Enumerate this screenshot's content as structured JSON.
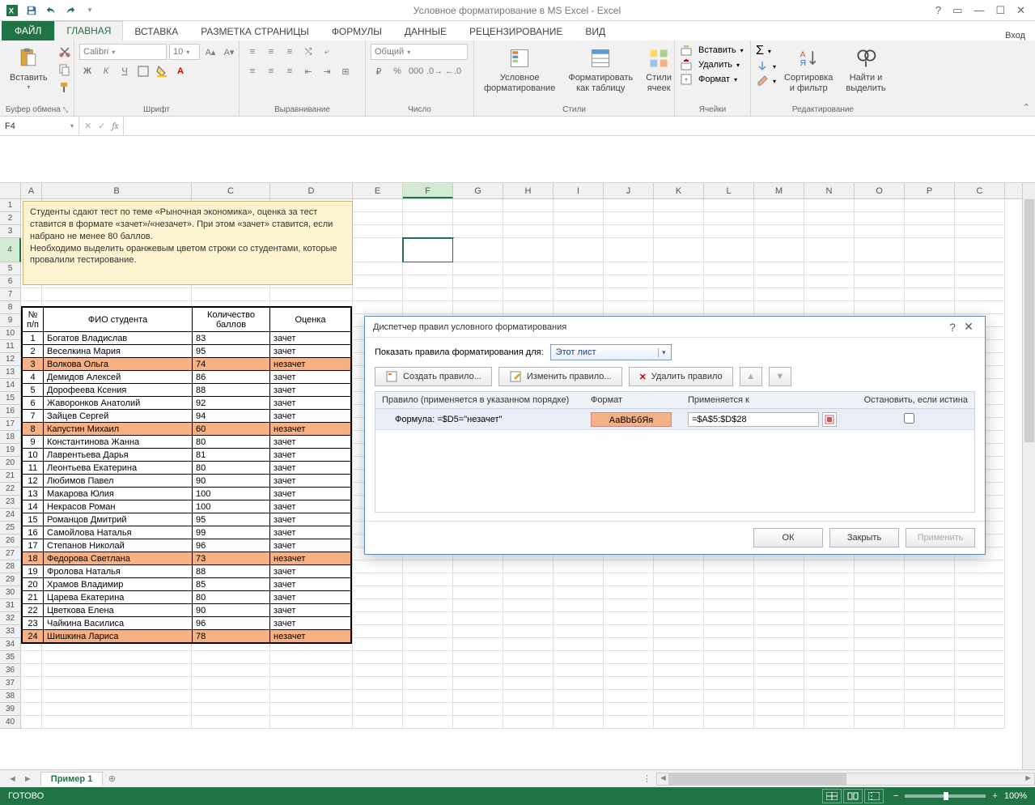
{
  "app": {
    "title": "Условное форматирование в MS Excel - Excel",
    "signin": "Вход"
  },
  "tabs": {
    "file": "ФАЙЛ",
    "home": "ГЛАВНАЯ",
    "insert": "ВСТАВКА",
    "layout": "РАЗМЕТКА СТРАНИЦЫ",
    "formulas": "ФОРМУЛЫ",
    "data": "ДАННЫЕ",
    "review": "РЕЦЕНЗИРОВАНИЕ",
    "view": "ВИД"
  },
  "ribbon": {
    "clipboard": {
      "label": "Буфер обмена",
      "paste": "Вставить"
    },
    "font": {
      "label": "Шрифт",
      "family": "Calibri",
      "size": "10"
    },
    "align": {
      "label": "Выравнивание"
    },
    "number": {
      "label": "Число",
      "format": "Общий"
    },
    "styles": {
      "label": "Стили",
      "cf": "Условное\nформатирование",
      "fmt_table": "Форматировать\nкак таблицу",
      "cell_styles": "Стили\nячеек"
    },
    "cells": {
      "label": "Ячейки",
      "insert": "Вставить",
      "delete": "Удалить",
      "format": "Формат"
    },
    "editing": {
      "label": "Редактирование",
      "sort": "Сортировка\nи фильтр",
      "find": "Найти и\nвыделить"
    }
  },
  "namebox": "F4",
  "note": "Студенты сдают тест по теме «Рыночная экономика», оценка за тест ставится в формате «зачет»/«незачет». При этом «зачет» ставится, если набрано не менее 80 баллов.\nНеобходимо выделить оранжевым цветом строки со студентами, которые провалили тестирование.",
  "table": {
    "headers": {
      "num": "№\nп/п",
      "name": "ФИО студента",
      "score": "Количество\nбаллов",
      "grade": "Оценка"
    },
    "rows": [
      {
        "n": "1",
        "name": "Богатов Владислав",
        "score": "83",
        "grade": "зачет",
        "fail": false
      },
      {
        "n": "2",
        "name": "Веселкина Мария",
        "score": "95",
        "grade": "зачет",
        "fail": false
      },
      {
        "n": "3",
        "name": "Волкова Ольга",
        "score": "74",
        "grade": "незачет",
        "fail": true
      },
      {
        "n": "4",
        "name": "Демидов Алексей",
        "score": "86",
        "grade": "зачет",
        "fail": false
      },
      {
        "n": "5",
        "name": "Дорофеева Ксения",
        "score": "88",
        "grade": "зачет",
        "fail": false
      },
      {
        "n": "6",
        "name": "Жаворонков Анатолий",
        "score": "92",
        "grade": "зачет",
        "fail": false
      },
      {
        "n": "7",
        "name": "Зайцев Сергей",
        "score": "94",
        "grade": "зачет",
        "fail": false
      },
      {
        "n": "8",
        "name": "Капустин Михаил",
        "score": "60",
        "grade": "незачет",
        "fail": true
      },
      {
        "n": "9",
        "name": "Константинова Жанна",
        "score": "80",
        "grade": "зачет",
        "fail": false
      },
      {
        "n": "10",
        "name": "Лаврентьева Дарья",
        "score": "81",
        "grade": "зачет",
        "fail": false
      },
      {
        "n": "11",
        "name": "Леонтьева Екатерина",
        "score": "80",
        "grade": "зачет",
        "fail": false
      },
      {
        "n": "12",
        "name": "Любимов Павел",
        "score": "90",
        "grade": "зачет",
        "fail": false
      },
      {
        "n": "13",
        "name": "Макарова Юлия",
        "score": "100",
        "grade": "зачет",
        "fail": false
      },
      {
        "n": "14",
        "name": "Некрасов Роман",
        "score": "100",
        "grade": "зачет",
        "fail": false
      },
      {
        "n": "15",
        "name": "Романцов Дмитрий",
        "score": "95",
        "grade": "зачет",
        "fail": false
      },
      {
        "n": "16",
        "name": "Самойлова Наталья",
        "score": "99",
        "grade": "зачет",
        "fail": false
      },
      {
        "n": "17",
        "name": "Степанов Николай",
        "score": "96",
        "grade": "зачет",
        "fail": false
      },
      {
        "n": "18",
        "name": "Федорова Светлана",
        "score": "73",
        "grade": "незачет",
        "fail": true
      },
      {
        "n": "19",
        "name": "Фролова Наталья",
        "score": "88",
        "grade": "зачет",
        "fail": false
      },
      {
        "n": "20",
        "name": "Храмов Владимир",
        "score": "85",
        "grade": "зачет",
        "fail": false
      },
      {
        "n": "21",
        "name": "Царева Екатерина",
        "score": "80",
        "grade": "зачет",
        "fail": false
      },
      {
        "n": "22",
        "name": "Цветкова Елена",
        "score": "90",
        "grade": "зачет",
        "fail": false
      },
      {
        "n": "23",
        "name": "Чайкина Василиса",
        "score": "96",
        "grade": "зачет",
        "fail": false
      },
      {
        "n": "24",
        "name": "Шишкина Лариса",
        "score": "78",
        "grade": "незачет",
        "fail": true
      }
    ]
  },
  "dialog": {
    "title": "Диспетчер правил условного форматирования",
    "show_for_label": "Показать правила форматирования для:",
    "show_for_value": "Этот лист",
    "new_rule": "Создать правило...",
    "edit_rule": "Изменить правило...",
    "delete_rule": "Удалить правило",
    "col_rule": "Правило (применяется в указанном порядке)",
    "col_format": "Формат",
    "col_applies": "Применяется к",
    "col_stop": "Остановить, если истина",
    "rule_text": "Формула: =$D5=\"незачет\"",
    "format_sample": "АаВbБбЯя",
    "applies_to": "=$A$5:$D$28",
    "ok": "ОК",
    "close": "Закрыть",
    "apply": "Применить"
  },
  "sheet": {
    "name": "Пример 1"
  },
  "status": {
    "ready": "ГОТОВО",
    "zoom": "100%"
  },
  "cols": [
    "A",
    "B",
    "C",
    "D",
    "E",
    "F",
    "G",
    "H",
    "I",
    "J",
    "K",
    "L",
    "M",
    "N",
    "O",
    "P",
    "C"
  ]
}
